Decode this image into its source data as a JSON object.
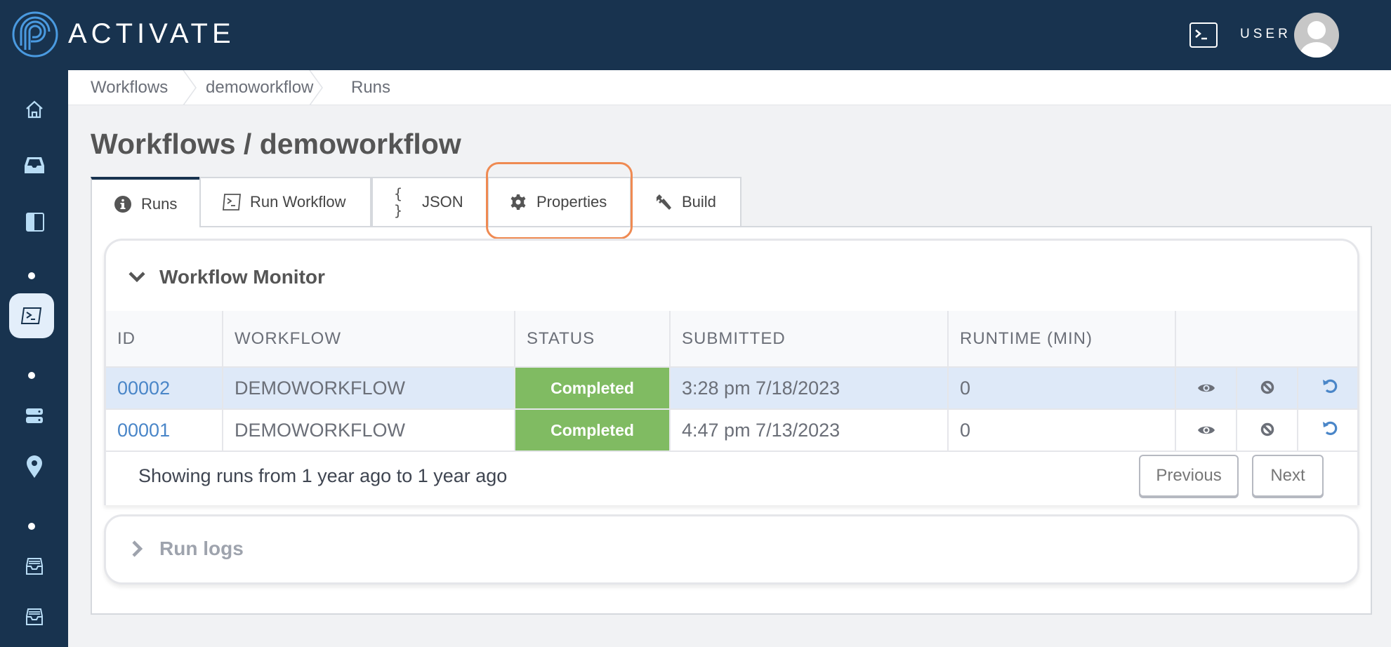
{
  "app": {
    "brand": "ACTIVATE",
    "user_label": "USER"
  },
  "sidebar": {
    "items": [
      {
        "icon": "home-icon"
      },
      {
        "icon": "inbox-icon"
      },
      {
        "icon": "sidebar-panel-icon"
      },
      {
        "icon": "terminal-icon",
        "active": true
      },
      {
        "icon": "server-icon"
      },
      {
        "icon": "map-pin-icon"
      },
      {
        "icon": "archive-icon"
      },
      {
        "icon": "archive-icon"
      }
    ]
  },
  "breadcrumb": [
    "Workflows",
    "demoworkflow",
    "Runs"
  ],
  "page_title": "Workflows / demoworkflow",
  "tabs": [
    {
      "label": "Runs",
      "icon": "info-circle-icon",
      "active": true
    },
    {
      "label": "Run Workflow",
      "icon": "terminal-icon"
    },
    {
      "label": "JSON",
      "icon": "braces-icon"
    },
    {
      "label": "Properties",
      "icon": "gear-icon",
      "highlighted": true
    },
    {
      "label": "Build",
      "icon": "wrench-icon"
    }
  ],
  "monitor": {
    "title": "Workflow Monitor",
    "columns": [
      "ID",
      "WORKFLOW",
      "STATUS",
      "SUBMITTED",
      "RUNTIME (MIN)"
    ],
    "rows": [
      {
        "id": "00002",
        "workflow": "DEMOWORKFLOW",
        "status": "Completed",
        "submitted": "3:28 pm 7/18/2023",
        "runtime": "0",
        "selected": true
      },
      {
        "id": "00001",
        "workflow": "DEMOWORKFLOW",
        "status": "Completed",
        "submitted": "4:47 pm 7/13/2023",
        "runtime": "0",
        "selected": false
      }
    ],
    "footer": "Showing runs from 1 year ago to 1 year ago",
    "previous_label": "Previous",
    "next_label": "Next"
  },
  "run_logs": {
    "title": "Run logs"
  },
  "colors": {
    "navy": "#18334f",
    "status_completed": "#80bb62",
    "link": "#4a86c8",
    "highlight": "#ef8a52",
    "selected_row": "#dee9f8"
  }
}
